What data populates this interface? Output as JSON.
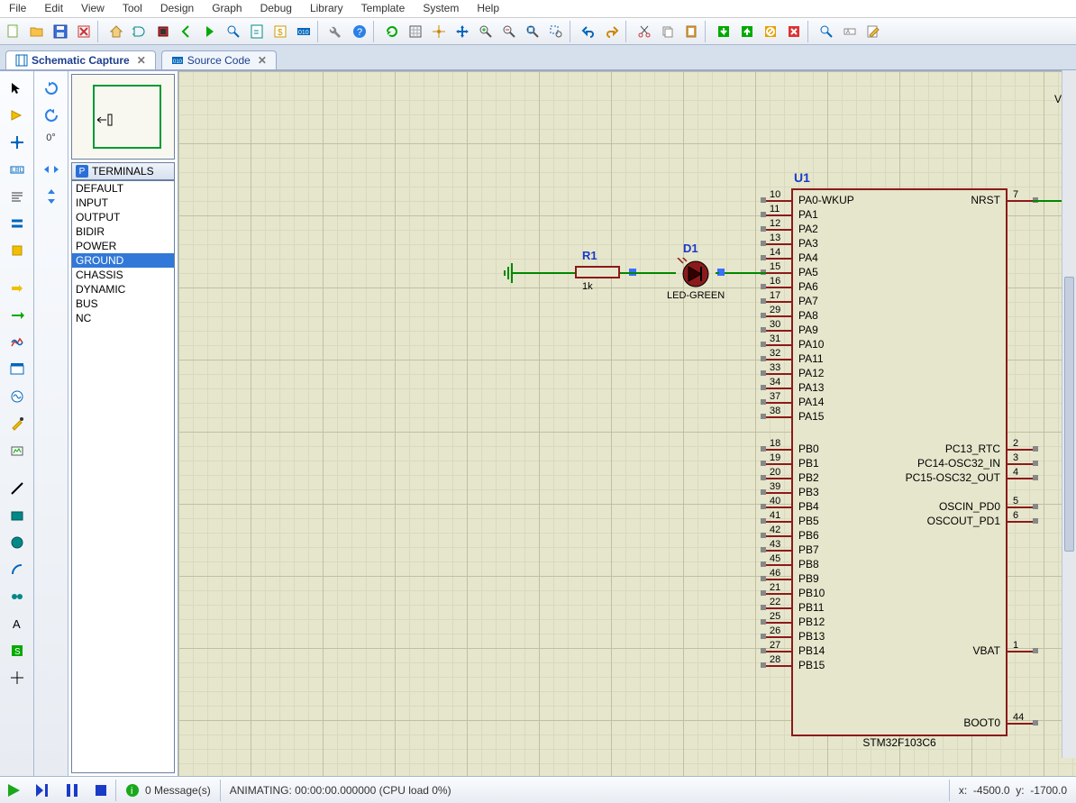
{
  "menu": [
    "File",
    "Edit",
    "View",
    "Tool",
    "Design",
    "Graph",
    "Debug",
    "Library",
    "Template",
    "System",
    "Help"
  ],
  "rotation_label": "0°",
  "tabs": {
    "schematic": "Schematic Capture",
    "source": "Source Code"
  },
  "terminals": {
    "header": "TERMINALS",
    "items": [
      "DEFAULT",
      "INPUT",
      "OUTPUT",
      "BIDIR",
      "POWER",
      "GROUND",
      "CHASSIS",
      "DYNAMIC",
      "BUS",
      "NC"
    ],
    "selected": "GROUND"
  },
  "schematic": {
    "vdd": "VDD",
    "mcu_ref": "U1",
    "mcu_part": "STM32F103C6",
    "resistor_ref": "R1",
    "resistor_val": "1k",
    "led_ref": "D1",
    "led_val": "LED-GREEN",
    "left_pins": [
      {
        "n": "10",
        "l": "PA0-WKUP"
      },
      {
        "n": "11",
        "l": "PA1"
      },
      {
        "n": "12",
        "l": "PA2"
      },
      {
        "n": "13",
        "l": "PA3"
      },
      {
        "n": "14",
        "l": "PA4"
      },
      {
        "n": "15",
        "l": "PA5"
      },
      {
        "n": "16",
        "l": "PA6"
      },
      {
        "n": "17",
        "l": "PA7"
      },
      {
        "n": "29",
        "l": "PA8"
      },
      {
        "n": "30",
        "l": "PA9"
      },
      {
        "n": "31",
        "l": "PA10"
      },
      {
        "n": "32",
        "l": "PA11"
      },
      {
        "n": "33",
        "l": "PA12"
      },
      {
        "n": "34",
        "l": "PA13"
      },
      {
        "n": "37",
        "l": "PA14"
      },
      {
        "n": "38",
        "l": "PA15"
      },
      {
        "n": "18",
        "l": "PB0"
      },
      {
        "n": "19",
        "l": "PB1"
      },
      {
        "n": "20",
        "l": "PB2"
      },
      {
        "n": "39",
        "l": "PB3"
      },
      {
        "n": "40",
        "l": "PB4"
      },
      {
        "n": "41",
        "l": "PB5"
      },
      {
        "n": "42",
        "l": "PB6"
      },
      {
        "n": "43",
        "l": "PB7"
      },
      {
        "n": "45",
        "l": "PB8"
      },
      {
        "n": "46",
        "l": "PB9"
      },
      {
        "n": "21",
        "l": "PB10"
      },
      {
        "n": "22",
        "l": "PB11"
      },
      {
        "n": "25",
        "l": "PB12"
      },
      {
        "n": "26",
        "l": "PB13"
      },
      {
        "n": "27",
        "l": "PB14"
      },
      {
        "n": "28",
        "l": "PB15"
      }
    ],
    "right_pins": [
      {
        "n": "7",
        "l": "NRST",
        "y": 0
      },
      {
        "n": "2",
        "l": "PC13_RTC",
        "y": 16
      },
      {
        "n": "3",
        "l": "PC14-OSC32_IN",
        "y": 17
      },
      {
        "n": "4",
        "l": "PC15-OSC32_OUT",
        "y": 18
      },
      {
        "n": "5",
        "l": "OSCIN_PD0",
        "y": 20
      },
      {
        "n": "6",
        "l": "OSCOUT_PD1",
        "y": 21
      },
      {
        "n": "1",
        "l": "VBAT",
        "y": 30
      },
      {
        "n": "44",
        "l": "BOOT0",
        "y": 35
      }
    ]
  },
  "sim": {
    "messages": "0 Message(s)",
    "anim": "ANIMATING: 00:00:00.000000 (CPU load 0%)",
    "coords_x_label": "x:",
    "coords_x": "-4500.0",
    "coords_y_label": "y:",
    "coords_y": "-1700.0"
  }
}
